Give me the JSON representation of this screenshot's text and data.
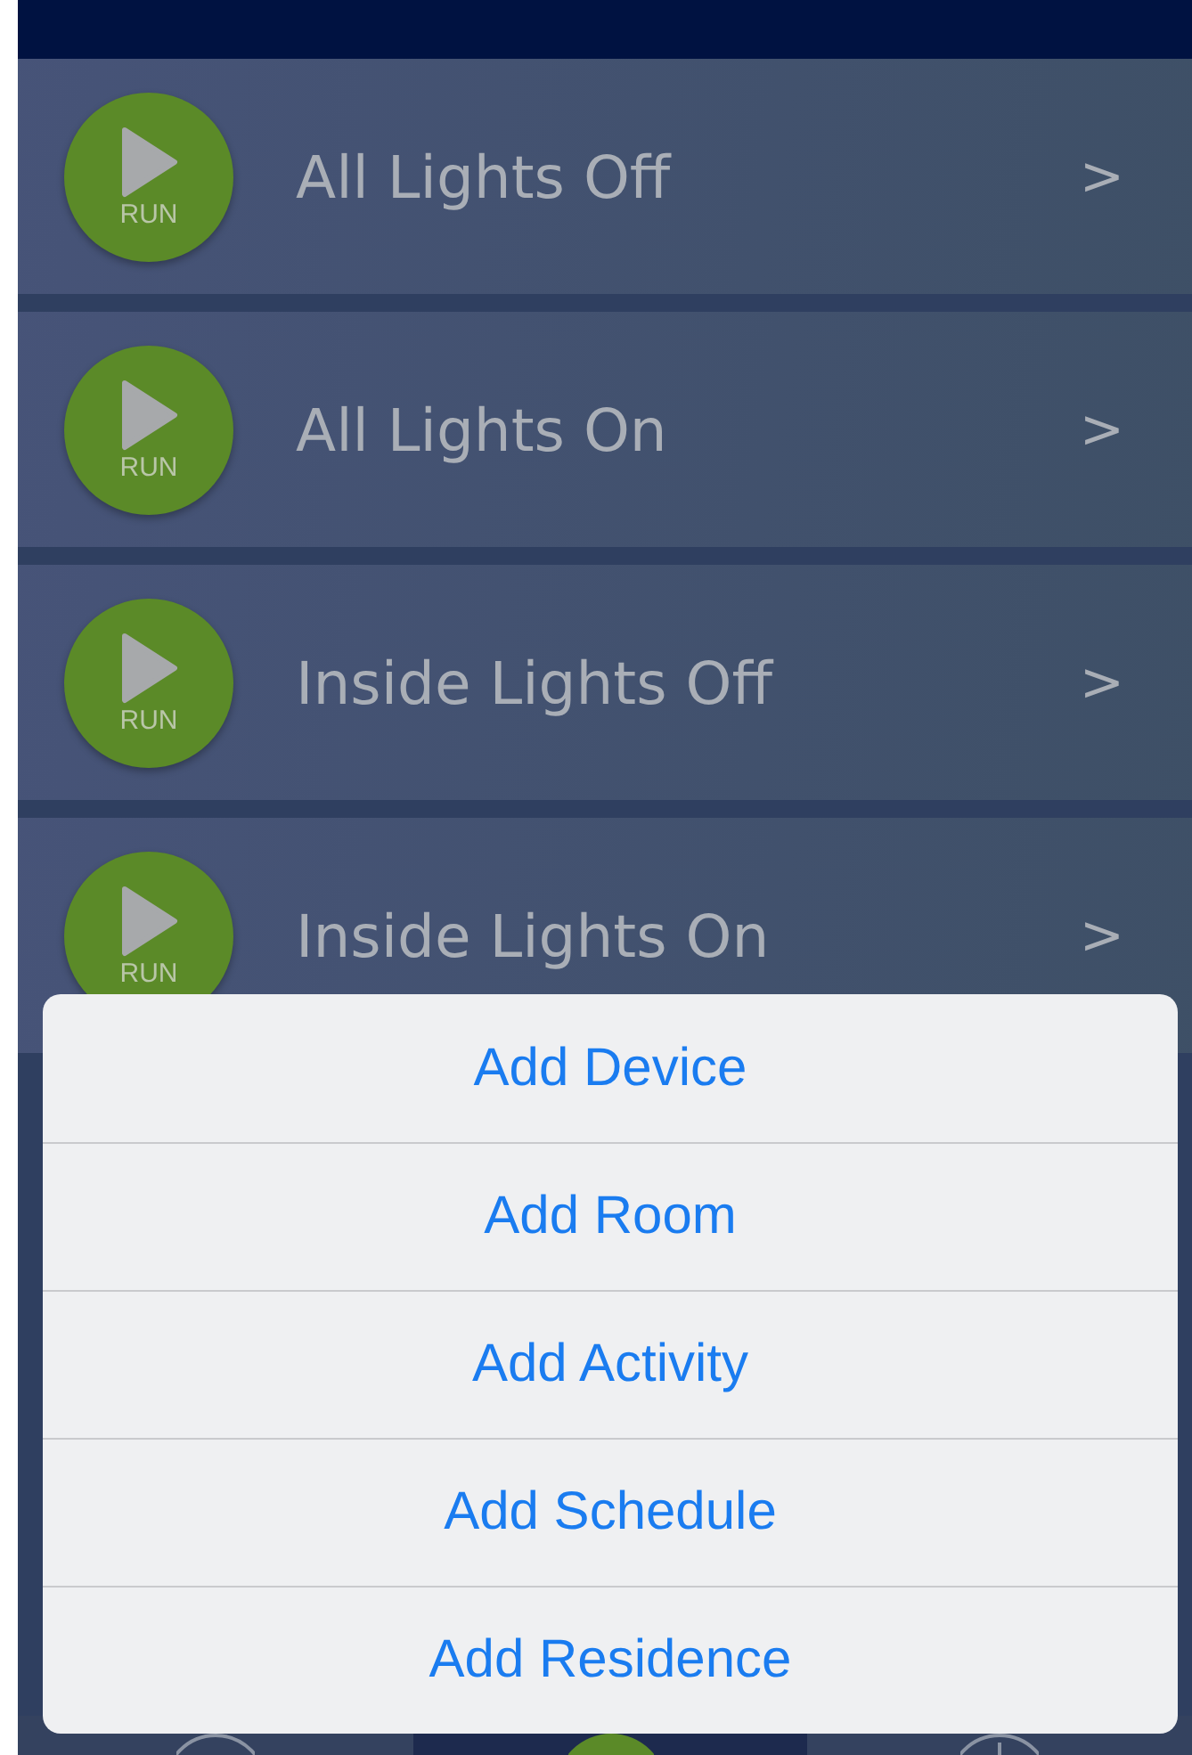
{
  "scenes": [
    {
      "title": "All Lights Off",
      "run_label": "RUN",
      "chevron": ">"
    },
    {
      "title": "All Lights On",
      "run_label": "RUN",
      "chevron": ">"
    },
    {
      "title": "Inside Lights Off",
      "run_label": "RUN",
      "chevron": ">"
    },
    {
      "title": "Inside Lights On",
      "run_label": "RUN",
      "chevron": ">"
    }
  ],
  "action_sheet": {
    "items": [
      "Add Device",
      "Add Room",
      "Add Activity",
      "Add Schedule",
      "Add Residence"
    ]
  },
  "tab_bar": {
    "tabs": [
      {
        "kind": "outline",
        "selected": false
      },
      {
        "kind": "center",
        "selected": true
      },
      {
        "kind": "plus",
        "selected": false
      }
    ]
  }
}
